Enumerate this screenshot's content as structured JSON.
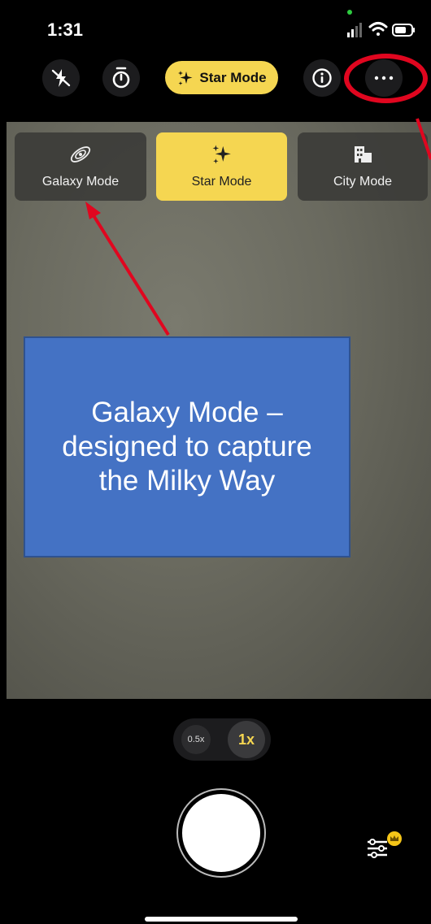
{
  "status_bar": {
    "time": "1:31",
    "icons": [
      "signal-icon",
      "wifi-icon",
      "battery-icon"
    ]
  },
  "toolbar": {
    "flash_icon": "flash-off-icon",
    "timer_icon": "timer-icon",
    "mode_pill_label": "Star Mode",
    "info_icon": "info-icon",
    "more_icon": "more-icon"
  },
  "modes": {
    "items": [
      {
        "label": "Galaxy Mode",
        "icon": "galaxy-icon",
        "active": false
      },
      {
        "label": "Star Mode",
        "icon": "sparkles-icon",
        "active": true
      },
      {
        "label": "City Mode",
        "icon": "city-icon",
        "active": false
      }
    ]
  },
  "annotation": {
    "text": "Galaxy Mode – designed to capture the Milky Way"
  },
  "zoom": {
    "option_small": "0.5x",
    "option_selected": "1x"
  },
  "controls": {
    "settings_icon": "sliders-icon",
    "premium_icon": "crown-icon"
  },
  "colors": {
    "accent": "#f5d651",
    "annotation_fill": "#4472c4",
    "annotation_arrow": "#e0061f"
  }
}
